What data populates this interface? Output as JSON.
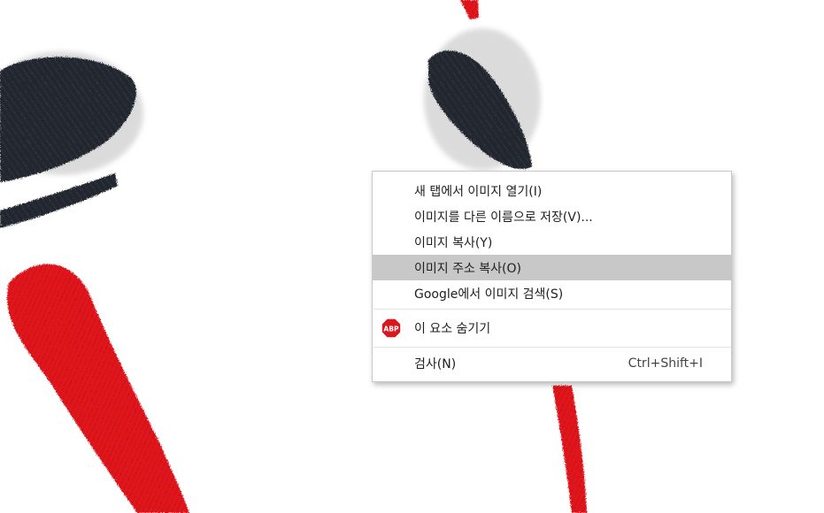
{
  "context_menu": {
    "items": [
      {
        "label": "새 탭에서 이미지 열기(I)"
      },
      {
        "label": "이미지를 다른 이름으로 저장(V)..."
      },
      {
        "label": "이미지 복사(Y)"
      },
      {
        "label": "이미지 주소 복사(O)",
        "highlighted": true
      },
      {
        "label": "Google에서 이미지 검색(S)"
      }
    ],
    "adblock_item": {
      "label": "이 요소 숨기기",
      "icon": "abp-icon",
      "icon_text": "ABP"
    },
    "inspect_item": {
      "label": "검사(N)",
      "shortcut": "Ctrl+Shift+I"
    }
  },
  "colors": {
    "highlight_bg": "#c8c8c8",
    "abp_red": "#d9171e",
    "art_red": "#e0141c",
    "art_black": "#1f232a"
  }
}
